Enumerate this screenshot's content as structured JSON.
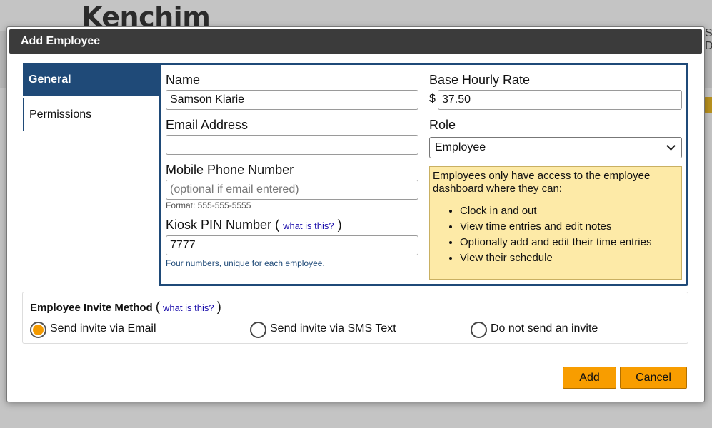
{
  "background": {
    "brand": "Kenchim"
  },
  "dialog": {
    "title": "Add Employee",
    "tabs": [
      {
        "label": "General",
        "active": true
      },
      {
        "label": "Permissions",
        "active": false
      }
    ],
    "form": {
      "name": {
        "label": "Name",
        "value": "Samson Kiarie"
      },
      "email": {
        "label": "Email Address",
        "value": ""
      },
      "mobile": {
        "label": "Mobile Phone Number",
        "placeholder": "(optional if email entered)",
        "format_hint": "Format: 555-555-5555"
      },
      "kiosk_pin": {
        "label": "Kiosk PIN Number",
        "help_link": "what is this?",
        "value": "7777",
        "hint": "Four numbers, unique for each employee."
      },
      "base_rate": {
        "label": "Base Hourly Rate",
        "currency": "$",
        "value": "37.50"
      },
      "role": {
        "label": "Role",
        "selected": "Employee"
      }
    },
    "role_note": {
      "intro": "Employees only have access to the employee dashboard where they can:",
      "items": [
        "Clock in and out",
        "View time entries and edit notes",
        "Optionally add and edit their time entries",
        "View their schedule"
      ]
    },
    "invite": {
      "title": "Employee Invite Method",
      "help_link": "what is this?",
      "options": [
        {
          "label": "Send invite via Email",
          "checked": true
        },
        {
          "label": "Send invite via SMS Text",
          "checked": false
        },
        {
          "label": "Do not send an invite",
          "checked": false
        }
      ]
    },
    "buttons": {
      "add": "Add",
      "cancel": "Cancel"
    }
  },
  "colors": {
    "accent": "#f89d00",
    "tab_active": "#1f4a78",
    "note_bg": "#fdeaa7"
  }
}
